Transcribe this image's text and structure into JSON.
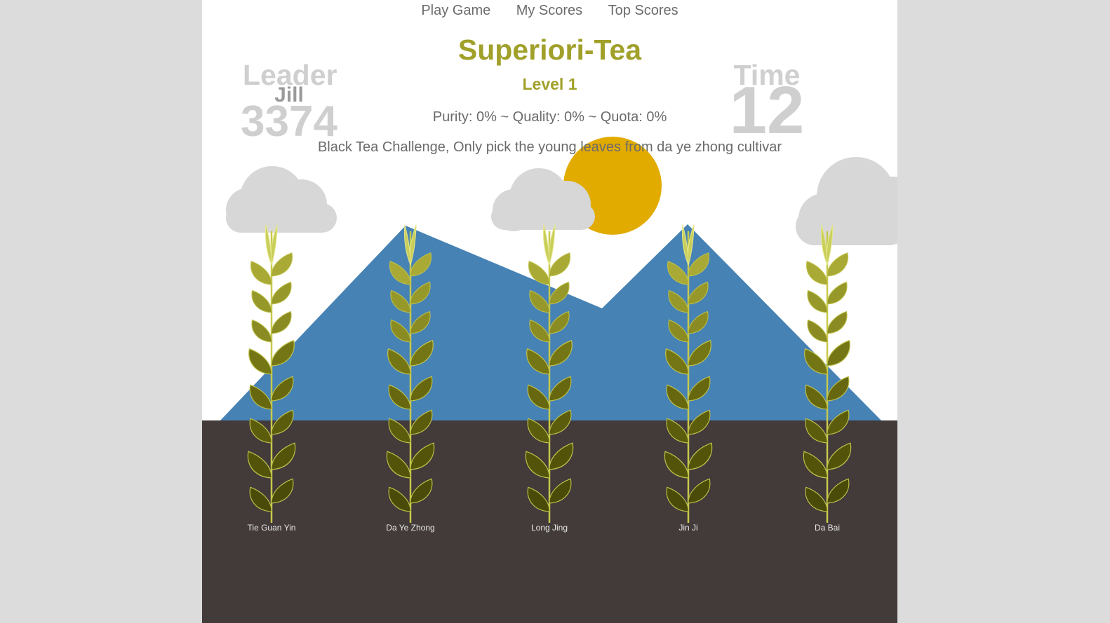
{
  "nav": [
    {
      "label": "Play Game"
    },
    {
      "label": "My Scores"
    },
    {
      "label": "Top Scores"
    }
  ],
  "title": "Superiori-Tea",
  "level": "Level 1",
  "stats": "Purity: 0% ~ Quality: 0% ~ Quota: 0%",
  "challenge": "Black Tea Challenge, Only pick the young leaves from da ye zhong cultivar",
  "leader": {
    "label": "Leader",
    "name": "Jill",
    "score": "3374"
  },
  "time": {
    "label": "Time",
    "value": "12"
  },
  "plants": [
    {
      "label": "Tie Guan Yin"
    },
    {
      "label": "Da Ye Zhong"
    },
    {
      "label": "Long Jing"
    },
    {
      "label": "Jin Ji"
    },
    {
      "label": "Da Bai"
    }
  ],
  "colors": {
    "page_bg": "#dcdcdc",
    "sky": "#ffffff",
    "mountain": "#4682b4",
    "soil": "#433a3a",
    "sun": "#e2ab00",
    "cloud": "#d7d7d7",
    "title": "#a0a02a"
  }
}
